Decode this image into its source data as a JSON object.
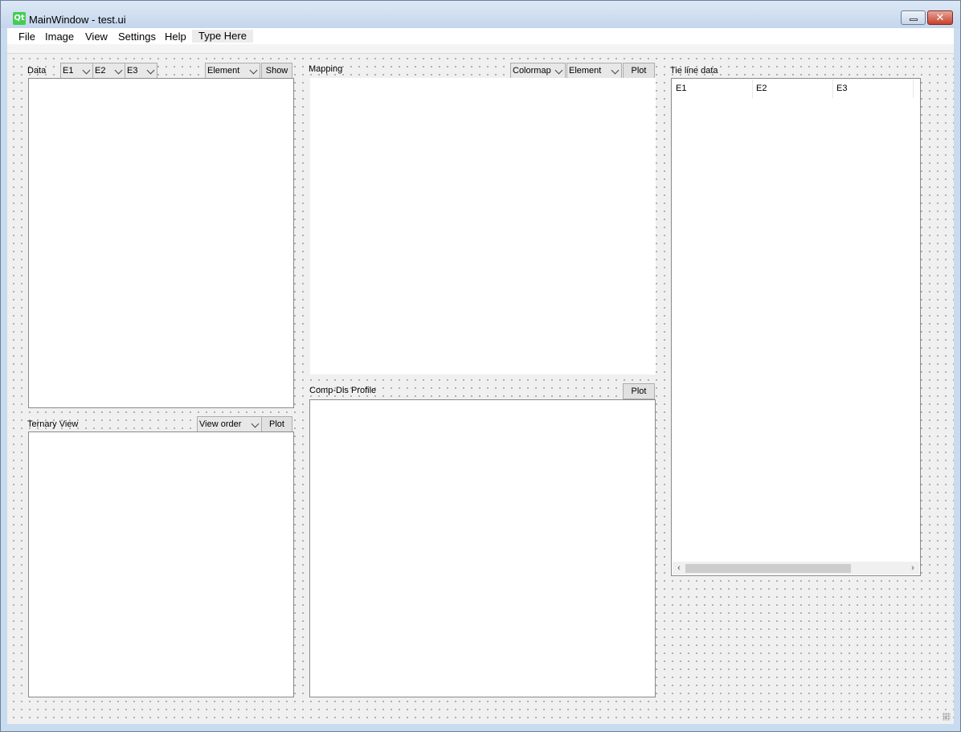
{
  "window": {
    "logo": "Qt",
    "title": "MainWindow - test.ui",
    "controls": {
      "minimize": "minimize-icon",
      "close": "close-icon",
      "close_glyph": "✕"
    }
  },
  "menubar": {
    "items": [
      "File",
      "Image",
      "View",
      "Settings",
      "Help"
    ],
    "type_here": "Type Here"
  },
  "data_panel": {
    "label": "Data",
    "combos": [
      "E1",
      "E2",
      "E3"
    ],
    "element_combo": "Element",
    "show_button": "Show"
  },
  "ternary_panel": {
    "label": "Ternary View",
    "view_order_combo": "View order",
    "plot_button": "Plot"
  },
  "mapping_panel": {
    "label": "Mapping",
    "colormap_combo": "Colormap",
    "element_combo": "Element",
    "plot_button": "Plot"
  },
  "comp_dis_panel": {
    "label": "Comp-Dis Profile",
    "plot_button": "Plot"
  },
  "tie_line_panel": {
    "label": "Tie line data",
    "columns": [
      "E1",
      "E2",
      "E3"
    ],
    "scroll_left": "‹",
    "scroll_right": "›"
  }
}
